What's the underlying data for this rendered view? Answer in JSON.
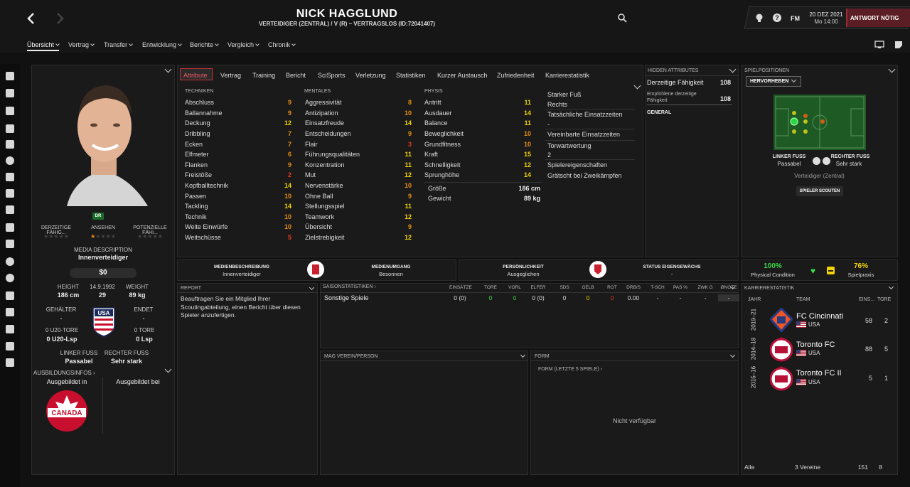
{
  "header": {
    "player_name": "NICK HAGGLUND",
    "subtitle": "VERTEIDIGER (ZENTRAL) / V (R) – VERTRAGSLOS (ID:72041407)",
    "date": "20 DEZ 2021",
    "time": "Mo 14:00",
    "fm_label": "FM",
    "continue_label": "ANTWORT NÖTIG",
    "nav": [
      "Übersicht",
      "Vertrag",
      "Transfer",
      "Entwicklung",
      "Berichte",
      "Vergleich",
      "Chronik"
    ]
  },
  "profile": {
    "role_badge": "DR",
    "labels": [
      "DERZEITIGE FÄHIG...",
      "ANSEHEN",
      "POTENZIELLE FÄHI..."
    ],
    "media_label": "MEDIA DESCRIPTION",
    "media_value": "Innenverteidiger",
    "value": "$0",
    "height_label": "HEIGHT",
    "height": "186 cm",
    "dob": "14.9.1992",
    "age": "29",
    "weight_label": "WEIGHT",
    "weight": "89 kg",
    "salary_label": "GEHÄLTER",
    "salary": "-",
    "ends_label": "ENDET",
    "ends": "-",
    "u20_goals": "0 U20-TORE",
    "u20_caps": "0 U20-Lsp",
    "goals": "0 TORE",
    "caps": "0 Lsp",
    "left_foot_label": "LINKER FUSS",
    "left_foot": "Passabel",
    "right_foot_label": "RECHTER FUSS",
    "right_foot": "Sehr stark",
    "training_info": "AUSBILDUNGSINFOS",
    "trained_in": "Ausgebildet in",
    "trained_at": "Ausgebildet bei",
    "canada": "CANADA",
    "usa_logo": "USA"
  },
  "tabs": [
    "Attribute",
    "Vertrag",
    "Training",
    "Bericht",
    "SciSports",
    "Verletzung",
    "Statistiken",
    "Kurzer Austausch",
    "Zufriedenheit",
    "Karrierestatistik"
  ],
  "attributes": {
    "technical_header": "TECHNIKEN",
    "mental_header": "MENTALES",
    "physical_header": "PHYSIS",
    "technical": [
      {
        "name": "Abschluss",
        "value": "9",
        "color": "o"
      },
      {
        "name": "Ballannahme",
        "value": "9",
        "color": "o"
      },
      {
        "name": "Deckung",
        "value": "12",
        "color": "y"
      },
      {
        "name": "Dribbling",
        "value": "7",
        "color": "o"
      },
      {
        "name": "Ecken",
        "value": "7",
        "color": "o"
      },
      {
        "name": "Elfmeter",
        "value": "6",
        "color": "o"
      },
      {
        "name": "Flanken",
        "value": "9",
        "color": "o"
      },
      {
        "name": "Freistöße",
        "value": "2",
        "color": "r"
      },
      {
        "name": "Kopfballtechnik",
        "value": "14",
        "color": "y"
      },
      {
        "name": "Passen",
        "value": "10",
        "color": "o"
      },
      {
        "name": "Tackling",
        "value": "14",
        "color": "y"
      },
      {
        "name": "Technik",
        "value": "10",
        "color": "o"
      },
      {
        "name": "Weite Einwürfe",
        "value": "10",
        "color": "o"
      },
      {
        "name": "Weitschüsse",
        "value": "5",
        "color": "r"
      }
    ],
    "mental": [
      {
        "name": "Aggressivität",
        "value": "8",
        "color": "o"
      },
      {
        "name": "Antizipation",
        "value": "10",
        "color": "o"
      },
      {
        "name": "Einsatzfreude",
        "value": "14",
        "color": "y"
      },
      {
        "name": "Entscheidungen",
        "value": "9",
        "color": "o"
      },
      {
        "name": "Flair",
        "value": "3",
        "color": "r"
      },
      {
        "name": "Führungsqualitäten",
        "value": "11",
        "color": "y"
      },
      {
        "name": "Konzentration",
        "value": "11",
        "color": "y"
      },
      {
        "name": "Mut",
        "value": "12",
        "color": "y"
      },
      {
        "name": "Nervenstärke",
        "value": "10",
        "color": "o"
      },
      {
        "name": "Ohne Ball",
        "value": "9",
        "color": "o"
      },
      {
        "name": "Stellungsspiel",
        "value": "11",
        "color": "y"
      },
      {
        "name": "Teamwork",
        "value": "12",
        "color": "y"
      },
      {
        "name": "Übersicht",
        "value": "9",
        "color": "o"
      },
      {
        "name": "Zielstrebigkeit",
        "value": "12",
        "color": "y"
      }
    ],
    "physical": [
      {
        "name": "Antritt",
        "value": "11",
        "color": "y"
      },
      {
        "name": "Ausdauer",
        "value": "14",
        "color": "y"
      },
      {
        "name": "Balance",
        "value": "11",
        "color": "y"
      },
      {
        "name": "Beweglichkeit",
        "value": "10",
        "color": "o"
      },
      {
        "name": "Grundfitness",
        "value": "10",
        "color": "o"
      },
      {
        "name": "Kraft",
        "value": "15",
        "color": "y"
      },
      {
        "name": "Schnelligkeit",
        "value": "12",
        "color": "y"
      },
      {
        "name": "Sprunghöhe",
        "value": "14",
        "color": "y"
      }
    ],
    "size_label": "Größe",
    "size": "186 cm",
    "weight_label": "Gewicht",
    "weight": "89 kg",
    "side": [
      {
        "label": "Starker Fuß",
        "value": "Rechts"
      },
      {
        "label": "Tatsächliche Einsatzzeiten",
        "value": "-"
      },
      {
        "label": "Vereinbarte Einsatzzeiten",
        "value": ""
      },
      {
        "label": "Torwartwertung",
        "value": "2"
      },
      {
        "label": "Spielereigenschaften",
        "value": "Grätscht bei Zweikämpfen"
      }
    ]
  },
  "hidden": {
    "title": "HIDDEN ATTRIBUTES",
    "current_label": "Derzeitige Fähigkeit",
    "current_value": "108",
    "recommended_label": "Empfohlene derzeitige Fähigkeit",
    "recommended_value": "108",
    "general_label": "GENERAL"
  },
  "positions": {
    "title": "SPIELPOSITIONEN",
    "dropdown": "HERVORHEBEN",
    "left_foot_label": "LINKER FUSS",
    "left_foot": "Passabel",
    "right_foot_label": "RECHTER FUSS",
    "right_foot": "Sehr stark",
    "position": "Verteidiger (Zentral)",
    "scout_button": "SPIELER SCOUTEN"
  },
  "info_strip": {
    "media_desc_label": "MEDIENBESCHREIBUNG",
    "media_desc": "Innenverteidiger",
    "media_handling_label": "MEDIENUMGANG",
    "media_handling": "Besonnen",
    "personality_label": "PERSÖNLICHKEIT",
    "personality": "Ausgeglichen",
    "homegrown_label": "STATUS EIGENGEWÄCHS",
    "homegrown": "-",
    "condition": "100%",
    "condition_label": "Physical Condition",
    "match_practice": "76%",
    "match_practice_label": "Spielpraxis"
  },
  "report": {
    "title": "REPORT",
    "text": "Beauftragen Sie ein Mitglied Ihrer Scoutingabteilung, einen Bericht über diesen Spieler anzufertigen."
  },
  "season_stats": {
    "title": "SAISONSTATISTIKEN",
    "columns": [
      "EINSÄTZE",
      "TORE",
      "VORL",
      "ELFER",
      "SDS",
      "GELB",
      "ROT",
      "DRB/S",
      "T-SCH",
      "PAS %",
      "ZWK G",
      "ØNOTE"
    ],
    "row_label": "Sonstige Spiele",
    "row": [
      "0 (0)",
      "0",
      "0",
      "0 (0)",
      "0",
      "0",
      "0",
      "0.00",
      "-",
      "-",
      "-",
      "-"
    ]
  },
  "likes": {
    "title": "MAG VEREIN/PERSON"
  },
  "form": {
    "title": "FORM",
    "subtitle": "FORM (LETZTE 5 SPIELE)",
    "empty": "Nicht verfügbar"
  },
  "career": {
    "title": "KARRIERESTATISTIK",
    "col_year": "JAHR",
    "col_team": "TEAM",
    "col_apps": "EINS...",
    "col_goals": "TORE",
    "rows": [
      {
        "year": "2019–21",
        "team": "FC Cincinnati",
        "nation": "USA",
        "apps": "58",
        "goals": "2"
      },
      {
        "year": "2014–18",
        "team": "Toronto FC",
        "nation": "USA",
        "apps": "88",
        "goals": "5"
      },
      {
        "year": "2015–16",
        "team": "Toronto FC II",
        "nation": "USA",
        "apps": "5",
        "goals": "1"
      }
    ],
    "total_label": "Alle",
    "total_clubs": "3 Vereine",
    "total_apps": "151",
    "total_goals": "8"
  }
}
